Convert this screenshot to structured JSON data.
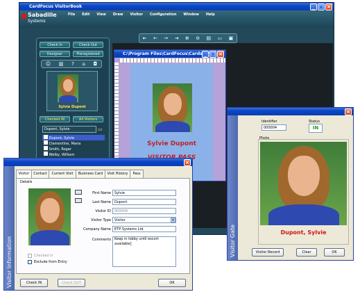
{
  "main": {
    "title": "CardFocus VisitorBook",
    "logo_line1": "Sabadille",
    "logo_line2": "Systems",
    "menu": [
      "File",
      "Edit",
      "View",
      "Draw",
      "Visitor",
      "Configuration",
      "Window",
      "Help"
    ],
    "checkin_tab": "Check In",
    "checkout_tab": "Check Out",
    "designer_tab": "Designer",
    "preregistered_tab": "Preregistered",
    "visitor_name": "Sylvie Dupont",
    "checked_in_tab": "Checked IN",
    "all_visitors_tab": "All Visitors",
    "search_value": "Dupont, Sylvie",
    "visitors": [
      "Dupont, Sylvie",
      "Clementine, Maria",
      "Smith, Roger",
      "Welby, William"
    ]
  },
  "badge_window": {
    "title": "C:\\Program Files\\CardFocus\\Cards\\ID\\E...",
    "name": "Sylvie Dupont",
    "pass_text": "VISITOR PASS"
  },
  "visitor_info": {
    "side_label": "Visitor Information",
    "tabs": [
      "Visitor",
      "Contact",
      "Current Visit",
      "Business Card",
      "Visit History",
      "Pass"
    ],
    "details_label": "Details",
    "first_name_label": "First Name",
    "first_name": "Sylvie",
    "last_name_label": "Last Name",
    "last_name": "Dupont",
    "visitor_id_label": "Visitor ID",
    "visitor_id": "000004",
    "visitor_type_label": "Visitor Type",
    "visitor_type": "Visitor",
    "company_label": "Company Name",
    "company": "ETP Systems Ltd",
    "comments_label": "Comments",
    "comments": "Keep in lobby until escort available]",
    "checked_in_label": "Checked In",
    "exclude_label": "Exclude from Entry",
    "check_in_button": "Check IN",
    "check_out_button": "Check OUT",
    "ok_button": "OK"
  },
  "gate": {
    "side_label": "Visitor Gate",
    "identifier_label": "Identifier",
    "identifier": "000004",
    "status_label": "Status",
    "status": "IN",
    "photo_label": "Photo",
    "name": "Dupont, Sylvie",
    "visitor_record_button": "Visitor Record",
    "clear_button": "Clear",
    "ok_button": "OK",
    "status_color": "#2c9a22",
    "name_color": "#d11414"
  }
}
